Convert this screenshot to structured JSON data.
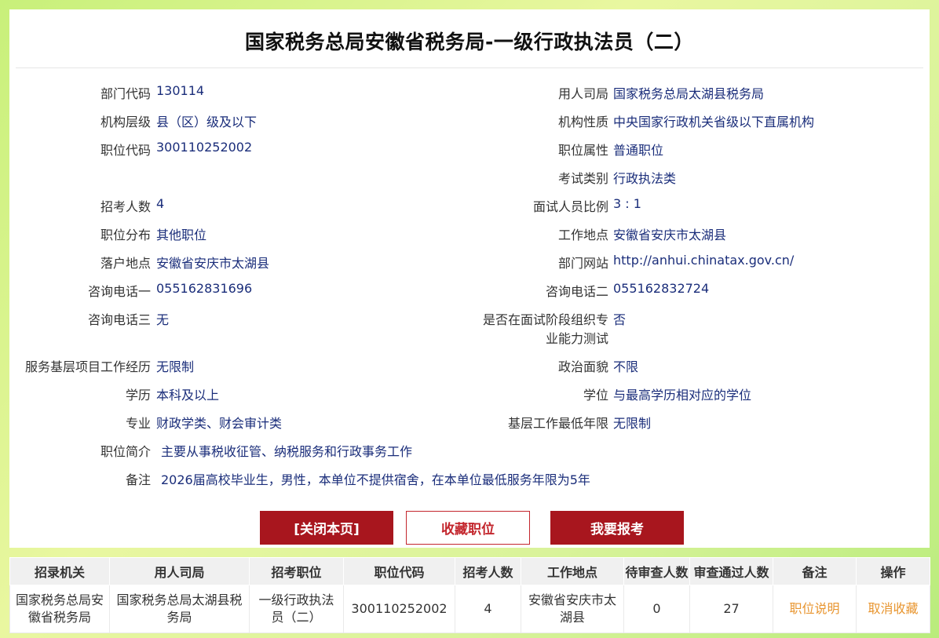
{
  "page_title": "国家税务总局安徽省税务局-一级行政执法员（二）",
  "fields": {
    "dept_code": {
      "label": "部门代码",
      "value": "130114"
    },
    "employer": {
      "label": "用人司局",
      "value": "国家税务总局太湖县税务局"
    },
    "org_level": {
      "label": "机构层级",
      "value": "县（区）级及以下"
    },
    "org_nature": {
      "label": "机构性质",
      "value": "中央国家行政机关省级以下直属机构"
    },
    "position_code": {
      "label": "职位代码",
      "value": "300110252002"
    },
    "position_attr": {
      "label": "职位属性",
      "value": "普通职位"
    },
    "exam_category": {
      "label": "考试类别",
      "value": "行政执法类"
    },
    "recruit_count": {
      "label": "招考人数",
      "value": "4"
    },
    "interview_ratio": {
      "label": "面试人员比例",
      "value": "3 : 1"
    },
    "position_distribution": {
      "label": "职位分布",
      "value": "其他职位"
    },
    "work_location": {
      "label": "工作地点",
      "value": "安徽省安庆市太湖县"
    },
    "settle_location": {
      "label": "落户地点",
      "value": "安徽省安庆市太湖县"
    },
    "dept_website": {
      "label": "部门网站",
      "value": "http://anhui.chinatax.gov.cn/"
    },
    "phone1": {
      "label": "咨询电话一",
      "value": "055162831696"
    },
    "phone2": {
      "label": "咨询电话二",
      "value": "055162832724"
    },
    "phone3": {
      "label": "咨询电话三",
      "value": "无"
    },
    "professional_test": {
      "label": "是否在面试阶段组织专业能力测试",
      "value": "否"
    },
    "grassroots_project": {
      "label": "服务基层项目工作经历",
      "value": "无限制"
    },
    "political_status": {
      "label": "政治面貌",
      "value": "不限"
    },
    "education": {
      "label": "学历",
      "value": "本科及以上"
    },
    "degree": {
      "label": "学位",
      "value": "与最高学历相对应的学位"
    },
    "major": {
      "label": "专业",
      "value": "财政学类、财会审计类"
    },
    "min_grassroots_years": {
      "label": "基层工作最低年限",
      "value": "无限制"
    },
    "position_intro": {
      "label": "职位简介",
      "value": "主要从事税收征管、纳税服务和行政事务工作"
    },
    "remarks": {
      "label": "备注",
      "value": "2026届高校毕业生，男性，本单位不提供宿舍，在本单位最低服务年限为5年"
    }
  },
  "buttons": {
    "close": "[关闭本页]",
    "favorite": "收藏职位",
    "apply": "我要报考"
  },
  "table": {
    "headers": [
      "招录机关",
      "用人司局",
      "招考职位",
      "职位代码",
      "招考人数",
      "工作地点",
      "待审查人数",
      "审查通过人数",
      "备注",
      "操作"
    ],
    "rows": [
      [
        "国家税务总局安徽省税务局",
        "国家税务总局太湖县税务局",
        "一级行政执法员（二）",
        "300110252002",
        "4",
        "安徽省安庆市太湖县",
        "0",
        "27",
        "职位说明",
        "取消收藏"
      ]
    ]
  },
  "colors": {
    "value_text": "#1a2d7a",
    "button_red": "#a8161e",
    "link_orange": "#e8952f"
  }
}
